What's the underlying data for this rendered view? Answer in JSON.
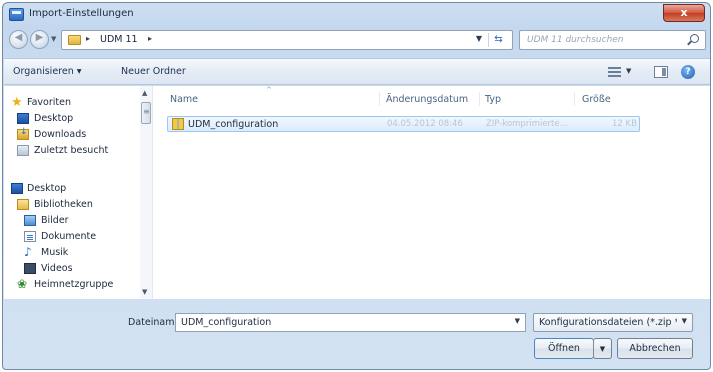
{
  "window": {
    "title": "Import-Einstellungen",
    "close_label": "x"
  },
  "address": {
    "breadcrumb": "UDM 11",
    "search_placeholder": "UDM 11 durchsuchen"
  },
  "toolbar": {
    "organize_label": "Organisieren ▾",
    "new_folder_label": "Neuer Ordner"
  },
  "icons": {
    "help": "?",
    "back": "back-arrow-icon",
    "forward": "forward-arrow-icon",
    "refresh": "refresh-icon",
    "search": "search-icon"
  },
  "nav": {
    "favorites_label": "Favoriten",
    "desktop_label": "Desktop",
    "downloads_label": "Downloads",
    "recent_label": "Zuletzt besucht",
    "desktop2_label": "Desktop",
    "libraries_label": "Bibliotheken",
    "pictures_label": "Bilder",
    "documents_label": "Dokumente",
    "music_label": "Musik",
    "videos_label": "Videos",
    "homegroup_label": "Heimnetzgruppe"
  },
  "columns": {
    "name": "Name",
    "modified": "Änderungsdatum",
    "type": "Typ",
    "size": "Größe"
  },
  "files": [
    {
      "name": "UDM_configuration",
      "modified": "04.05.2012 08:46",
      "type": "ZIP-komprimierte...",
      "size": "12 KB"
    }
  ],
  "footer": {
    "filename_label": "Dateiname:",
    "filename_value": "UDM_configuration",
    "filter_value": "Konfigurationsdateien (*.zip *.i",
    "open_label": "Öffnen",
    "cancel_label": "Abbrechen"
  },
  "colors": {
    "selection_fill": "#dcecfc",
    "selection_border": "#9fc6ef",
    "close_red": "#c23a22"
  }
}
